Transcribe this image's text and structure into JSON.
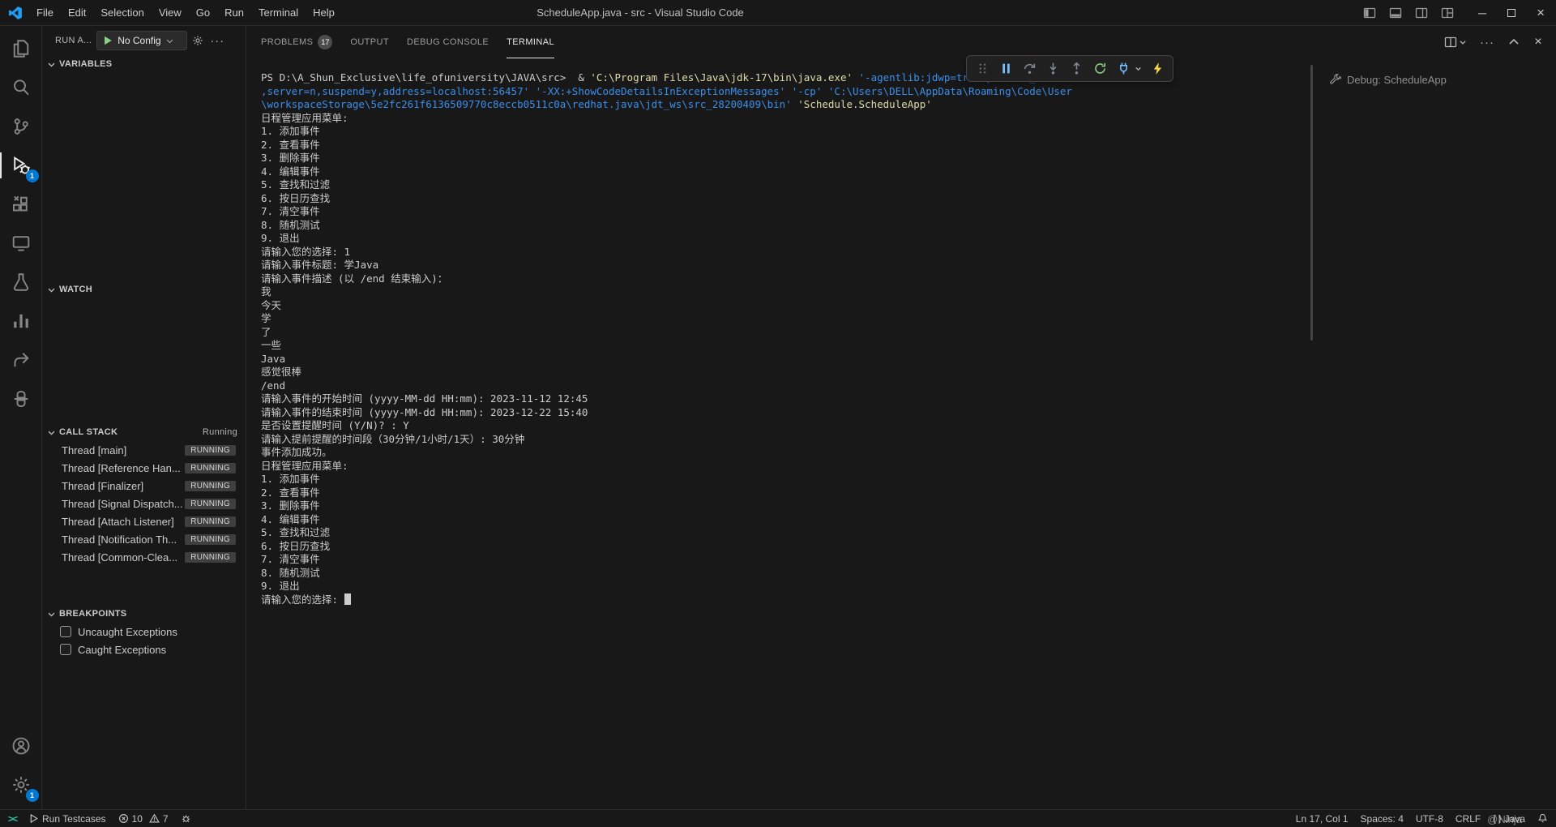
{
  "title_bar": {
    "menus": [
      "File",
      "Edit",
      "Selection",
      "View",
      "Go",
      "Run",
      "Terminal",
      "Help"
    ],
    "title": "ScheduleApp.java - src - Visual Studio Code"
  },
  "activity_bar": {
    "icons": [
      "explorer",
      "search",
      "source-control",
      "run-and-debug",
      "extensions",
      "remote-explorer",
      "testing",
      "charts",
      "share",
      "python",
      "accounts",
      "settings"
    ],
    "run_debug_badge": "1",
    "settings_badge": "1"
  },
  "sidebar": {
    "header": {
      "title": "RUN A...",
      "config_label": "No Config"
    },
    "variables": {
      "label": "VARIABLES"
    },
    "watch": {
      "label": "WATCH"
    },
    "call_stack": {
      "label": "CALL STACK",
      "status": "Running",
      "threads": [
        {
          "name": "Thread [main]",
          "state": "RUNNING"
        },
        {
          "name": "Thread [Reference Han...",
          "state": "RUNNING"
        },
        {
          "name": "Thread [Finalizer]",
          "state": "RUNNING"
        },
        {
          "name": "Thread [Signal Dispatch...",
          "state": "RUNNING"
        },
        {
          "name": "Thread [Attach Listener]",
          "state": "RUNNING"
        },
        {
          "name": "Thread [Notification Th...",
          "state": "RUNNING"
        },
        {
          "name": "Thread [Common-Clea...",
          "state": "RUNNING"
        }
      ]
    },
    "breakpoints": {
      "label": "BREAKPOINTS",
      "items": [
        {
          "label": "Uncaught Exceptions"
        },
        {
          "label": "Caught Exceptions"
        }
      ]
    }
  },
  "panel": {
    "tabs": [
      {
        "label": "PROBLEMS",
        "badge": "17"
      },
      {
        "label": "OUTPUT"
      },
      {
        "label": "DEBUG CONSOLE"
      },
      {
        "label": "TERMINAL",
        "state": "active"
      }
    ],
    "terminal_list": [
      {
        "label": "Debug: ScheduleApp"
      }
    ]
  },
  "terminal": {
    "colors": {
      "fg": "#cccccc",
      "yellow": "#dcdcaa",
      "blue": "#3b8eea"
    },
    "lines": [
      [
        {
          "t": "PS D:\\A_Shun_Exclusive\\life_ofuniversity\\JAVA\\src>  & ",
          "c": "fg"
        },
        {
          "t": "'C:\\Program Files\\Java\\jdk-17\\bin\\java.exe' ",
          "c": "yellow"
        },
        {
          "t": "'-agentlib:jdwp=transport=dt_socket",
          "c": "blue"
        }
      ],
      [
        {
          "t": ",server=n,suspend=y,address=localhost:56457' ",
          "c": "blue"
        },
        {
          "t": "'-XX:+ShowCodeDetailsInExceptionMessages' ",
          "c": "blue"
        },
        {
          "t": "'-cp' ",
          "c": "blue"
        },
        {
          "t": "'C:\\Users\\DELL\\AppData\\Roaming\\Code\\User",
          "c": "blue"
        }
      ],
      [
        {
          "t": "\\workspaceStorage\\5e2fc261f6136509770c8eccb0511c0a\\redhat.java\\jdt_ws\\src_28200409\\bin' ",
          "c": "blue"
        },
        {
          "t": "'Schedule.ScheduleApp'",
          "c": "yellow"
        }
      ],
      "日程管理应用菜单:",
      "1. 添加事件",
      "2. 查看事件",
      "3. 删除事件",
      "4. 编辑事件",
      "5. 查找和过滤",
      "6. 按日历查找",
      "7. 清空事件",
      "8. 随机测试",
      "9. 退出",
      "请输入您的选择: 1",
      "请输入事件标题: 学Java",
      "请输入事件描述 (以 /end 结束输入)：",
      "我",
      "今天",
      "学",
      "了",
      "一些",
      "Java",
      "感觉很棒",
      "/end",
      "请输入事件的开始时间 (yyyy-MM-dd HH:mm): 2023-11-12 12:45",
      "请输入事件的结束时间 (yyyy-MM-dd HH:mm): 2023-12-22 15:40",
      "是否设置提醒时间 (Y/N)? : Y",
      "请输入提前提醒的时间段（30分钟/1小时/1天）: 30分钟",
      "事件添加成功。",
      "日程管理应用菜单:",
      "1. 添加事件",
      "2. 查看事件",
      "3. 删除事件",
      "4. 编辑事件",
      "5. 查找和过滤",
      "6. 按日历查找",
      "7. 清空事件",
      "8. 随机测试",
      "9. 退出",
      "请输入您的选择: "
    ]
  },
  "status_bar": {
    "run_testcases": "Run Testcases",
    "errors": "10",
    "warnings": "7",
    "cursor_position": "Ln 17, Col 1",
    "indentation": "Spaces: 4",
    "encoding": "UTF-8",
    "eol": "CRLF",
    "language": "Java",
    "watermark": "@Ninja"
  }
}
